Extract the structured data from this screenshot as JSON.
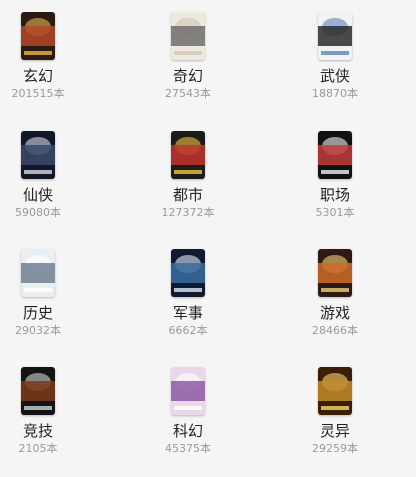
{
  "categories": [
    {
      "name": "玄幻",
      "count": "201515本",
      "cover_colors": [
        "#2a1a12",
        "#b4492a",
        "#e7b74a"
      ]
    },
    {
      "name": "奇幻",
      "count": "27543本",
      "cover_colors": [
        "#efe8dc",
        "#6f6f6f",
        "#cfc4b5"
      ]
    },
    {
      "name": "武侠",
      "count": "18870本",
      "cover_colors": [
        "#f2f2f2",
        "#2b2b2b",
        "#5a83b6"
      ]
    },
    {
      "name": "仙侠",
      "count": "59080本",
      "cover_colors": [
        "#111827",
        "#3b4a6b",
        "#d8d8e6"
      ]
    },
    {
      "name": "都市",
      "count": "127372本",
      "cover_colors": [
        "#1c1c1c",
        "#c3322c",
        "#f0c23a"
      ]
    },
    {
      "name": "职场",
      "count": "5301本",
      "cover_colors": [
        "#111111",
        "#c43b3b",
        "#f1f1f1"
      ]
    },
    {
      "name": "历史",
      "count": "29032本",
      "cover_colors": [
        "#e9eef2",
        "#6f8092",
        "#ffffff"
      ]
    },
    {
      "name": "军事",
      "count": "6662本",
      "cover_colors": [
        "#0f1930",
        "#3a6ea0",
        "#dfe9f6"
      ]
    },
    {
      "name": "游戏",
      "count": "28466本",
      "cover_colors": [
        "#2b1b10",
        "#d06a2a",
        "#f2d07b"
      ]
    },
    {
      "name": "竞技",
      "count": "2105本",
      "cover_colors": [
        "#141414",
        "#7a3a1a",
        "#d2d2d2"
      ]
    },
    {
      "name": "科幻",
      "count": "45375本",
      "cover_colors": [
        "#ead7ea",
        "#8b5aa3",
        "#ffffff"
      ]
    },
    {
      "name": "灵异",
      "count": "29259本",
      "cover_colors": [
        "#3a1f08",
        "#c58a2a",
        "#ffd26a"
      ]
    }
  ]
}
